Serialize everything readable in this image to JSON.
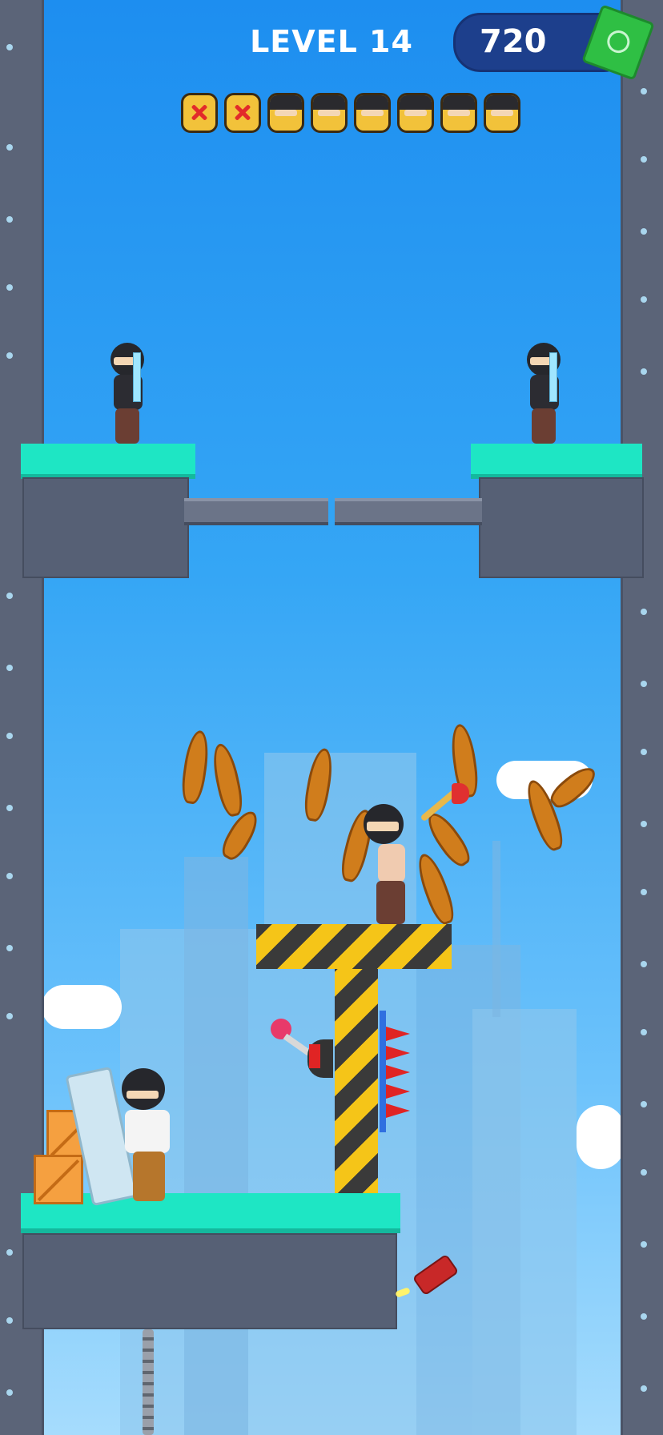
{
  "hud": {
    "level_label": "LEVEL 14",
    "cash_amount": "720",
    "cash_icon": "money-bill-icon"
  },
  "enemies": {
    "total": 8,
    "defeated": 2,
    "icons": [
      "dead",
      "dead",
      "alive",
      "alive",
      "alive",
      "alive",
      "alive",
      "alive"
    ]
  },
  "colors": {
    "platform_top": "#1ee6c4",
    "wall": "#5b6478",
    "sky": "#2aa0f0",
    "cash_pill": "#1d3f8c",
    "hazard_yellow": "#f5c518",
    "spike_red": "#e02424"
  },
  "scene": {
    "objects": [
      "ninja-guard-left",
      "ninja-guard-right",
      "ninja-center",
      "hero-with-shield",
      "lever",
      "spike-trap",
      "dynamite",
      "crates",
      "chain"
    ]
  }
}
